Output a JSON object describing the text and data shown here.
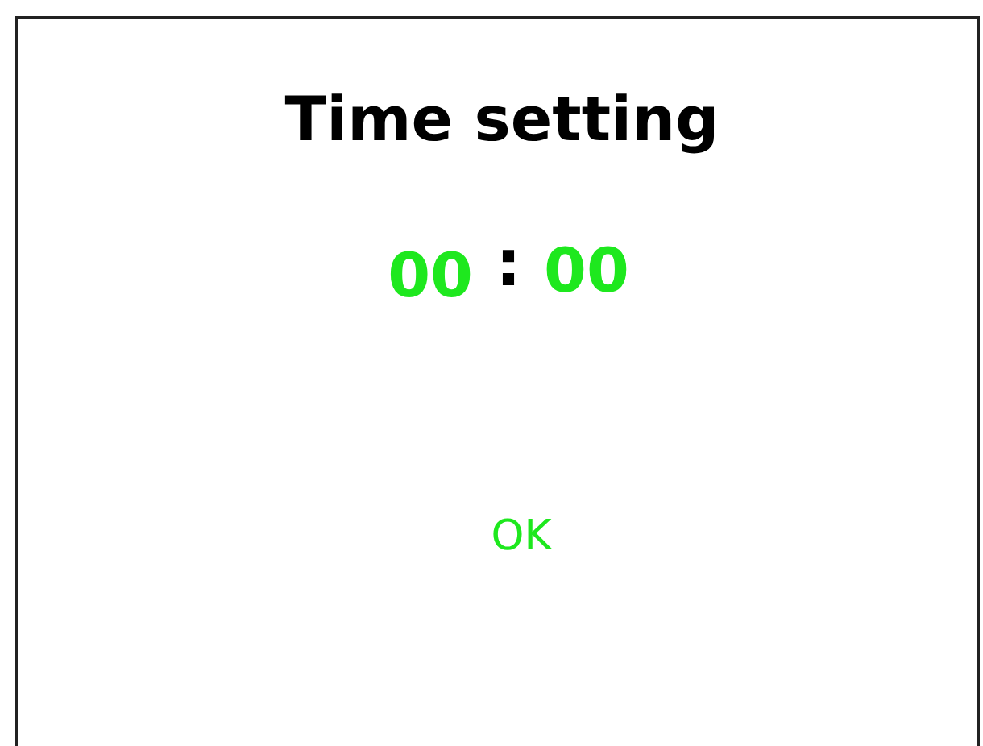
{
  "title": "Time setting",
  "time": {
    "hours": "00",
    "separator": ":",
    "minutes": "00"
  },
  "buttons": [
    "OK"
  ]
}
